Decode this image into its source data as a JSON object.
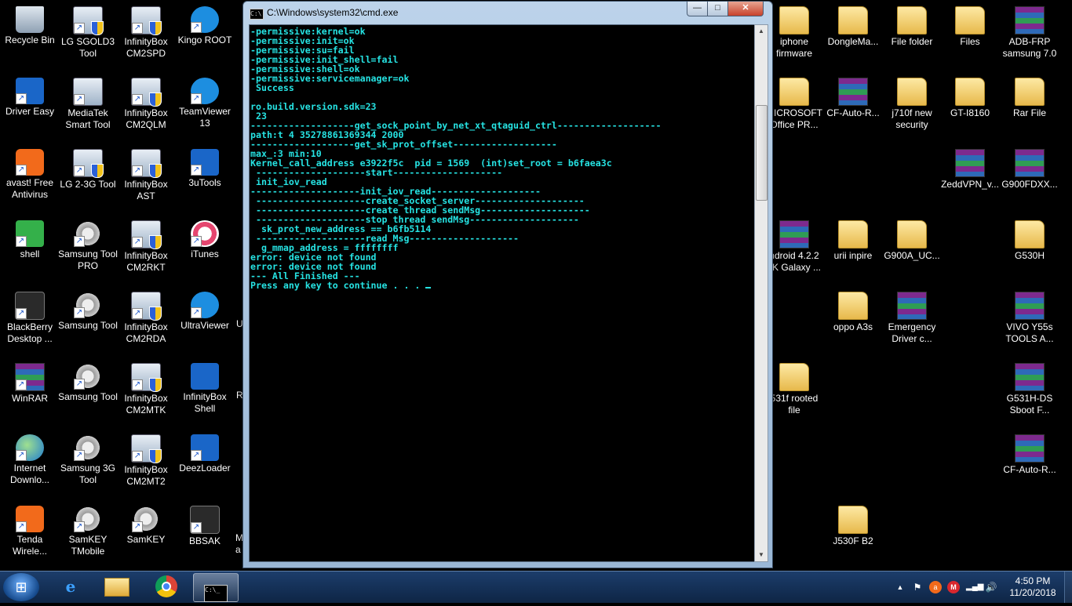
{
  "desktop": {
    "left_icons": [
      {
        "label": "Recycle Bin",
        "icon": "recycle-bin-icon"
      },
      {
        "label": "LG SGOLD3 Tool",
        "icon": "app-shield-icon"
      },
      {
        "label": "InfinityBox CM2SPD",
        "icon": "app-shield-icon"
      },
      {
        "label": "Kingo ROOT",
        "icon": "kingo-root-icon"
      },
      {
        "label": "Driver Easy",
        "icon": "driver-easy-icon"
      },
      {
        "label": "MediaTek Smart Tool",
        "icon": "app-icon"
      },
      {
        "label": "InfinityBox CM2QLM",
        "icon": "app-shield-icon",
        "badge": "QLM"
      },
      {
        "label": "TeamViewer 13",
        "icon": "teamviewer-icon"
      },
      {
        "label": "avast! Free Antivirus",
        "icon": "avast-icon"
      },
      {
        "label": "LG 2-3G Tool",
        "icon": "app-shield-icon"
      },
      {
        "label": "InfinityBox AST",
        "icon": "app-shield-icon",
        "badge": "AST"
      },
      {
        "label": "3uTools",
        "icon": "3utools-icon"
      },
      {
        "label": "shell",
        "icon": "shell-icon"
      },
      {
        "label": "Samsung Tool PRO",
        "icon": "gear-icon"
      },
      {
        "label": "InfinityBox CM2RKT",
        "icon": "app-shield-icon",
        "badge": "RKT"
      },
      {
        "label": "iTunes",
        "icon": "itunes-icon"
      },
      {
        "label": "BlackBerry Desktop ...",
        "icon": "blackberry-icon"
      },
      {
        "label": "Samsung Tool",
        "icon": "gear-icon"
      },
      {
        "label": "InfinityBox CM2RDA",
        "icon": "app-shield-icon",
        "badge": "RDA"
      },
      {
        "label": "UltraViewer",
        "icon": "ultraviewer-icon"
      },
      {
        "label": "WinRAR",
        "icon": "winrar-icon"
      },
      {
        "label": "Samsung Tool",
        "icon": "gear-icon"
      },
      {
        "label": "InfinityBox CM2MTK",
        "icon": "app-shield-icon",
        "badge": "MTK"
      },
      {
        "label": "InfinityBox Shell",
        "icon": "infinitybox-shell-icon"
      },
      {
        "label": "Internet Downlo...",
        "icon": "internet-download-icon"
      },
      {
        "label": "Samsung 3G Tool",
        "icon": "gear-icon"
      },
      {
        "label": "InfinityBox CM2MT2",
        "icon": "app-shield-icon",
        "badge": "MTK"
      },
      {
        "label": "DeezLoader",
        "icon": "deezloader-icon"
      },
      {
        "label": "Tenda Wirele...",
        "icon": "tenda-icon"
      },
      {
        "label": "SamKEY TMobile",
        "icon": "gear-icon"
      },
      {
        "label": "SamKEY",
        "icon": "gear-icon"
      },
      {
        "label": "BBSAK",
        "icon": "bbsak-icon"
      }
    ],
    "right_icons": [
      {
        "label": "iphone firmware",
        "icon": "folder-icon"
      },
      {
        "label": "DongleMa...",
        "icon": "folder-icon"
      },
      {
        "label": "File folder",
        "icon": "folder-icon"
      },
      {
        "label": "Files",
        "icon": "folder-icon"
      },
      {
        "label": "ADB-FRP samsung 7.0",
        "icon": "winrar-archive-icon"
      },
      {
        "label": "MICROSOFT Office PR...",
        "icon": "folder-icon"
      },
      {
        "label": "CF-Auto-R...",
        "icon": "winrar-archive-icon"
      },
      {
        "label": "j710f new security",
        "icon": "folder-icon"
      },
      {
        "label": "GT-I8160",
        "icon": "folder-icon"
      },
      {
        "label": "Rar File",
        "icon": "folder-icon"
      },
      {
        "label": "ZeddVPN_v...",
        "icon": "winrar-archive-icon"
      },
      {
        "label": "G900FDXX...",
        "icon": "winrar-archive-icon"
      },
      {
        "label": "ndroid 4.2.2 JK Galaxy ...",
        "icon": "winrar-archive-icon"
      },
      {
        "label": "urii inpire",
        "icon": "folder-icon"
      },
      {
        "label": "G900A_UC...",
        "icon": "folder-icon"
      },
      {
        "label": "G530H",
        "icon": "folder-icon"
      },
      {
        "label": "oppo A3s",
        "icon": "folder-icon"
      },
      {
        "label": "Emergency Driver c...",
        "icon": "winrar-archive-icon"
      },
      {
        "label": "VIVO Y55s TOOLS A...",
        "icon": "winrar-archive-icon"
      },
      {
        "label": "531f rooted file",
        "icon": "folder-icon"
      },
      {
        "label": "G531H-DS Sboot F...",
        "icon": "winrar-archive-icon"
      },
      {
        "label": "CF-Auto-R...",
        "icon": "winrar-archive-icon"
      },
      {
        "label": "J530F B2",
        "icon": "folder-icon"
      }
    ],
    "partial_labels": [
      "U",
      "R",
      "M a"
    ]
  },
  "cmd": {
    "title": "C:\\Windows\\system32\\cmd.exe",
    "min_label": "—",
    "max_label": "□",
    "close_label": "✕",
    "lines": [
      "-permissive:kernel=ok",
      "-permissive:init=ok",
      "-permissive:su=fail",
      "-permissive:init_shell=fail",
      "-permissive:shell=ok",
      "-permissive:servicemanager=ok",
      " Success",
      "",
      "ro.build.version.sdk=23",
      " 23",
      "-------------------get_sock_point_by_net_xt_qtaguid_ctrl-------------------",
      "path:t 4 35278861369344 2000",
      "-------------------get_sk_prot_offset-------------------",
      "max_:3 min:10",
      "Kernel_call_address e3922f5c  pid = 1569  (int)set_root = b6faea3c",
      " --------------------start--------------------",
      " init_iov_read",
      "--------------------init_iov_read--------------------",
      " --------------------create_socket_server--------------------",
      " --------------------create thread sendMsg--------------------",
      " --------------------stop thread sendMsg--------------------",
      "  sk_prot_new_address == b6fb5114",
      " --------------------read Msg--------------------",
      "  g_mmap_address = ffffffff",
      "error: device not found",
      "error: device not found",
      "--- All Finished ---",
      "Press any key to continue . . . "
    ]
  },
  "taskbar": {
    "start_label": "⊞",
    "ie_label": "e",
    "clock_time": "4:50 PM",
    "clock_date": "11/20/2018",
    "tray_arrow": "▲",
    "tray_flag": "⚑",
    "tray_avast": "a",
    "tray_mega": "M",
    "tray_signal": "▂▄▆",
    "tray_volume": "🔊"
  },
  "colors": {
    "console_text": "#26e3e3",
    "console_bg": "#000000",
    "taskbar": "#1c3d6b"
  }
}
